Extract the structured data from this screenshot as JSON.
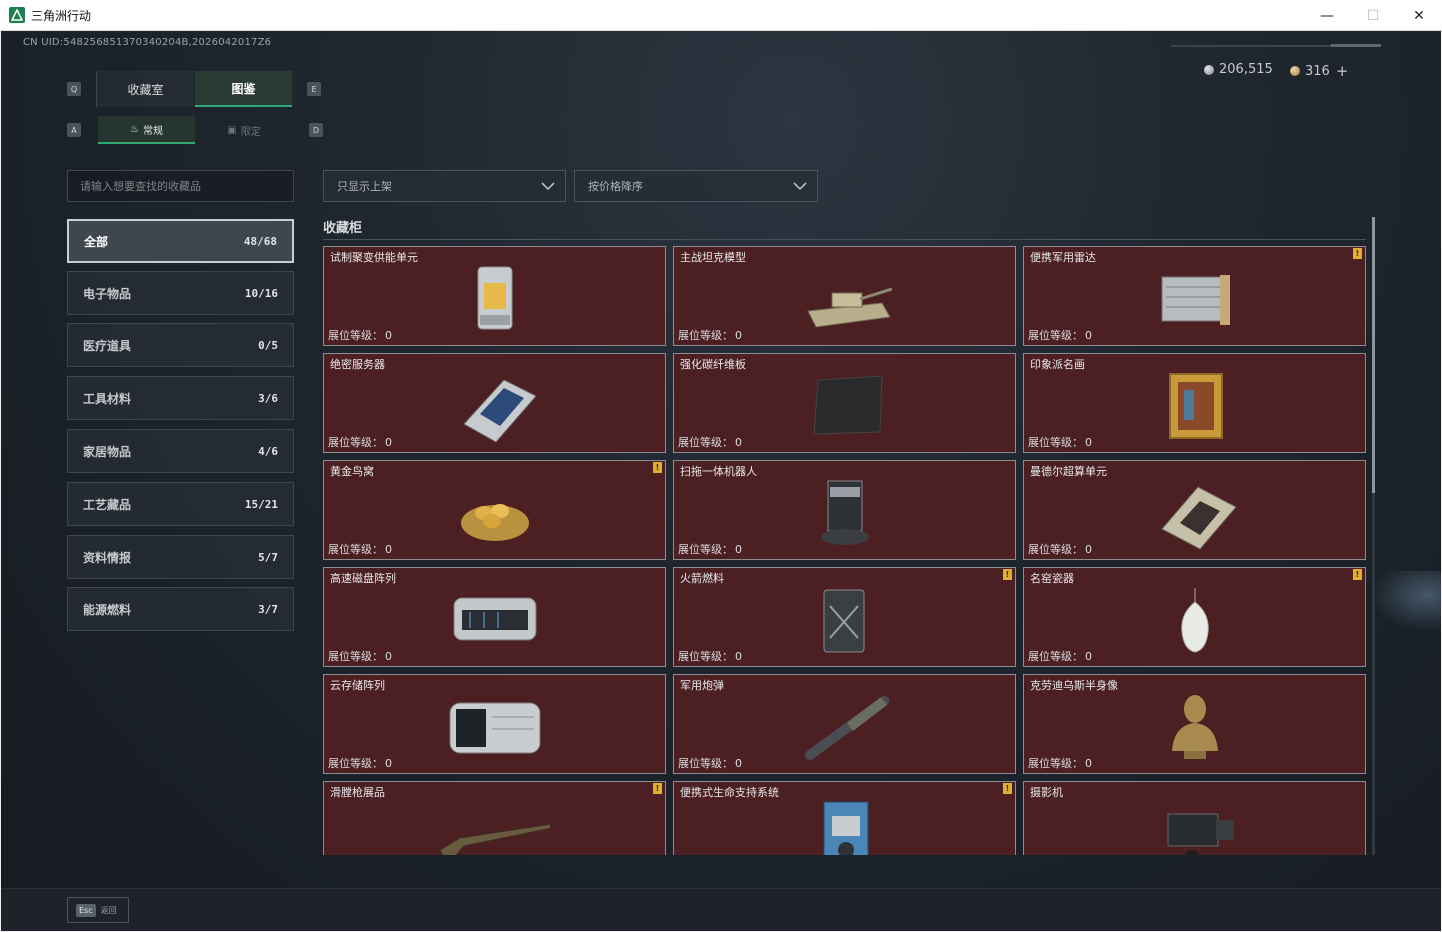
{
  "window": {
    "title": "三角洲行动",
    "minimize": "—",
    "maximize": "☐",
    "close": "✕"
  },
  "uid": "CN UID:548256851370340204B,2026042017Z6",
  "currency": {
    "silver": "206,515",
    "gold": "316",
    "add": "+"
  },
  "keys": {
    "q": "Q",
    "e": "E",
    "a": "A",
    "d": "D"
  },
  "tabs": {
    "collection_room": "收藏室",
    "catalog": "图鉴"
  },
  "subtabs": {
    "regular": "常规",
    "limited": "限定"
  },
  "search": {
    "placeholder": "请输入想要查找的收藏品"
  },
  "categories": [
    {
      "label": "全部",
      "count": "48/68"
    },
    {
      "label": "电子物品",
      "count": "10/16"
    },
    {
      "label": "医疗道具",
      "count": "0/5"
    },
    {
      "label": "工具材料",
      "count": "3/6"
    },
    {
      "label": "家居物品",
      "count": "4/6"
    },
    {
      "label": "工艺藏品",
      "count": "15/21"
    },
    {
      "label": "资料情报",
      "count": "5/7"
    },
    {
      "label": "能源燃料",
      "count": "3/7"
    }
  ],
  "filters": {
    "shelf": "只显示上架",
    "sort": "按价格降序"
  },
  "section_title": "收藏柜",
  "level_label": "展位等级：",
  "items": [
    {
      "name": "试制聚变供能单元",
      "level": "0",
      "badge": false,
      "icon": "fusion-unit"
    },
    {
      "name": "主战坦克模型",
      "level": "0",
      "badge": false,
      "icon": "tank-model"
    },
    {
      "name": "便携军用雷达",
      "level": "0",
      "badge": true,
      "icon": "radar"
    },
    {
      "name": "绝密服务器",
      "level": "0",
      "badge": false,
      "icon": "server"
    },
    {
      "name": "强化碳纤维板",
      "level": "0",
      "badge": false,
      "icon": "carbon-plate"
    },
    {
      "name": "印象派名画",
      "level": "0",
      "badge": false,
      "icon": "painting"
    },
    {
      "name": "黄金鸟窝",
      "level": "0",
      "badge": true,
      "icon": "golden-nest"
    },
    {
      "name": "扫拖一体机器人",
      "level": "0",
      "badge": false,
      "icon": "robot-vacuum"
    },
    {
      "name": "曼德尔超算单元",
      "level": "0",
      "badge": false,
      "icon": "supercomputer"
    },
    {
      "name": "高速磁盘阵列",
      "level": "0",
      "badge": false,
      "icon": "disk-array"
    },
    {
      "name": "火箭燃料",
      "level": "0",
      "badge": true,
      "icon": "fuel-can"
    },
    {
      "name": "名窑瓷器",
      "level": "0",
      "badge": true,
      "icon": "porcelain"
    },
    {
      "name": "云存储阵列",
      "level": "0",
      "badge": false,
      "icon": "cloud-storage"
    },
    {
      "name": "军用炮弹",
      "level": "0",
      "badge": false,
      "icon": "artillery-shell"
    },
    {
      "name": "克劳迪乌斯半身像",
      "level": "0",
      "badge": false,
      "icon": "bust"
    },
    {
      "name": "滑膛枪展品",
      "level": "",
      "badge": true,
      "icon": "musket"
    },
    {
      "name": "便携式生命支持系统",
      "level": "",
      "badge": true,
      "icon": "life-support"
    },
    {
      "name": "摄影机",
      "level": "",
      "badge": false,
      "icon": "camera"
    }
  ],
  "badge_glyph": "!",
  "bottom": {
    "esc_key": "Esc",
    "esc_label": "返回"
  },
  "colors": {
    "accent": "#2fa874",
    "card_bg": "#4c1f23",
    "badge": "#e0b12e"
  }
}
